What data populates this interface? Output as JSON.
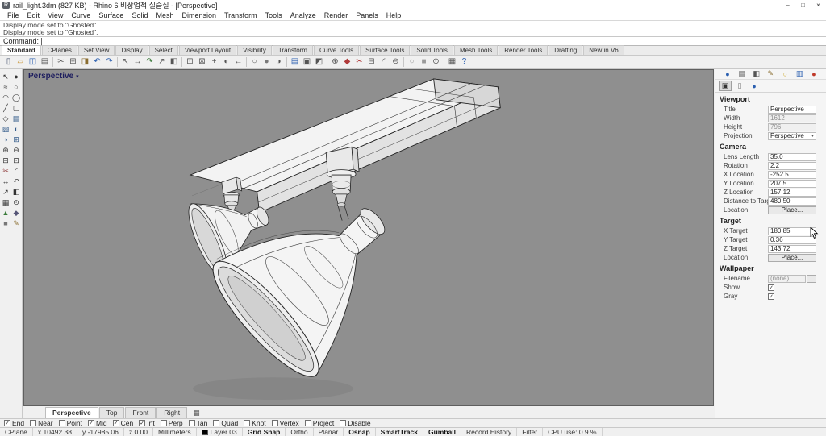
{
  "window": {
    "title": "rail_light.3dm (827 KB) - Rhino 6 비상업적 실습실 - [Perspective]",
    "app_icon_glyph": "R",
    "controls": [
      {
        "name": "minimize",
        "glyph": "–"
      },
      {
        "name": "maximize",
        "glyph": "□"
      },
      {
        "name": "close",
        "glyph": "×"
      }
    ]
  },
  "menubar": {
    "items": [
      "File",
      "Edit",
      "View",
      "Curve",
      "Surface",
      "Solid",
      "Mesh",
      "Dimension",
      "Transform",
      "Tools",
      "Analyze",
      "Render",
      "Panels",
      "Help"
    ]
  },
  "command": {
    "history": [
      "Display mode set to \"Ghosted\".",
      "Display mode set to \"Ghosted\"."
    ],
    "prompt_label": "Command:"
  },
  "toolbar_tabs": {
    "active": "Standard",
    "items": [
      "Standard",
      "CPlanes",
      "Set View",
      "Display",
      "Select",
      "Viewport Layout",
      "Visibility",
      "Transform",
      "Curve Tools",
      "Surface Tools",
      "Solid Tools",
      "Mesh Tools",
      "Render Tools",
      "Drafting",
      "New in V6"
    ]
  },
  "toolbar": {
    "icons": [
      {
        "n": "new-file",
        "g": "▯",
        "c": "#44526b"
      },
      {
        "n": "open-file",
        "g": "▱",
        "c": "#c8922f"
      },
      {
        "n": "save-file",
        "g": "◫",
        "c": "#2b5fb0"
      },
      {
        "n": "print",
        "g": "▤",
        "c": "#555555"
      },
      {
        "sep": true
      },
      {
        "n": "cut",
        "g": "✂",
        "c": "#555555"
      },
      {
        "n": "copy",
        "g": "⊞",
        "c": "#555555"
      },
      {
        "n": "paste",
        "g": "◨",
        "c": "#8a6d2f"
      },
      {
        "n": "undo",
        "g": "↶",
        "c": "#2b5fb0"
      },
      {
        "n": "redo",
        "g": "↷",
        "c": "#2b5fb0"
      },
      {
        "sep": true
      },
      {
        "n": "select",
        "g": "↖",
        "c": "#555555"
      },
      {
        "n": "move",
        "g": "↔",
        "c": "#555555"
      },
      {
        "n": "rotate",
        "g": "↷",
        "c": "#3a7a3a"
      },
      {
        "n": "scale",
        "g": "↗",
        "c": "#555555"
      },
      {
        "n": "mirror",
        "g": "◧",
        "c": "#555555"
      },
      {
        "sep": true
      },
      {
        "n": "zoom-window",
        "g": "⊡",
        "c": "#555555"
      },
      {
        "n": "zoom-extents",
        "g": "⊠",
        "c": "#555555"
      },
      {
        "n": "pan-view",
        "g": "+",
        "c": "#555555"
      },
      {
        "n": "rotate-view",
        "g": "◐",
        "c": "#555555"
      },
      {
        "n": "undo-view",
        "g": "←",
        "c": "#555555"
      },
      {
        "sep": true
      },
      {
        "n": "wireframe-display",
        "g": "○",
        "c": "#555555"
      },
      {
        "n": "shaded-display",
        "g": "●",
        "c": "#7a7a7a"
      },
      {
        "n": "ghosted-display",
        "g": "◑",
        "c": "#555555"
      },
      {
        "sep": true
      },
      {
        "n": "layers",
        "g": "▤",
        "c": "#2b5fb0"
      },
      {
        "n": "properties",
        "g": "▣",
        "c": "#555555"
      },
      {
        "n": "display-options",
        "g": "◩",
        "c": "#555555"
      },
      {
        "sep": true
      },
      {
        "n": "join",
        "g": "⊕",
        "c": "#555555"
      },
      {
        "n": "explode",
        "g": "◆",
        "c": "#b03a3a"
      },
      {
        "n": "trim",
        "g": "✂",
        "c": "#b03a3a"
      },
      {
        "n": "split",
        "g": "⊟",
        "c": "#555555"
      },
      {
        "n": "fillet",
        "g": "◜",
        "c": "#555555"
      },
      {
        "n": "offset",
        "g": "⊖",
        "c": "#555555"
      },
      {
        "sep": true
      },
      {
        "n": "hide-object",
        "g": "○",
        "c": "#9a9a9a"
      },
      {
        "n": "lock-object",
        "g": "■",
        "c": "#9a9a9a"
      },
      {
        "n": "group",
        "g": "⊙",
        "c": "#555555"
      },
      {
        "sep": true
      },
      {
        "n": "grid-snap-toggle",
        "g": "▦",
        "c": "#555555"
      },
      {
        "n": "help",
        "g": "?",
        "c": "#2b5fb0"
      }
    ]
  },
  "palette": {
    "icons": [
      {
        "n": "select-arrow",
        "g": "↖",
        "c": "#333333"
      },
      {
        "n": "point",
        "g": "●",
        "c": "#333333"
      },
      {
        "n": "curve-freeform",
        "g": "≈",
        "c": "#333333"
      },
      {
        "n": "circle",
        "g": "○",
        "c": "#333333"
      },
      {
        "n": "arc",
        "g": "◠",
        "c": "#333333"
      },
      {
        "n": "ellipse",
        "g": "◯",
        "c": "#333333"
      },
      {
        "n": "polyline",
        "g": "╱",
        "c": "#333333"
      },
      {
        "n": "rectangle",
        "g": "▢",
        "c": "#333333"
      },
      {
        "n": "polygon",
        "g": "◇",
        "c": "#333333"
      },
      {
        "n": "surface-plane",
        "g": "▤",
        "c": "#335b8a"
      },
      {
        "n": "surface-corner",
        "g": "▧",
        "c": "#335b8a"
      },
      {
        "n": "revolve",
        "g": "◐",
        "c": "#335b8a"
      },
      {
        "n": "sweep",
        "g": "◑",
        "c": "#335b8a"
      },
      {
        "n": "extrude",
        "g": "⊞",
        "c": "#335b8a"
      },
      {
        "n": "boolean-union",
        "g": "⊕",
        "c": "#333333"
      },
      {
        "n": "boolean-difference",
        "g": "⊖",
        "c": "#333333"
      },
      {
        "n": "split",
        "g": "⊟",
        "c": "#333333"
      },
      {
        "n": "project",
        "g": "⊡",
        "c": "#333333"
      },
      {
        "n": "trim",
        "g": "✂",
        "c": "#8a3333"
      },
      {
        "n": "fillet-curve",
        "g": "◜",
        "c": "#333333"
      },
      {
        "n": "move",
        "g": "↔",
        "c": "#333333"
      },
      {
        "n": "rotate",
        "g": "↶",
        "c": "#333333"
      },
      {
        "n": "scale",
        "g": "↗",
        "c": "#333333"
      },
      {
        "n": "mirror",
        "g": "◧",
        "c": "#333333"
      },
      {
        "n": "array",
        "g": "▦",
        "c": "#333333"
      },
      {
        "n": "orient",
        "g": "⊙",
        "c": "#333333"
      },
      {
        "n": "mesh-tools",
        "g": "▲",
        "c": "#3a7a3a"
      },
      {
        "n": "solid-tools",
        "g": "◆",
        "c": "#555577"
      },
      {
        "n": "lock",
        "g": "■",
        "c": "#777777"
      },
      {
        "n": "annotate",
        "g": "✎",
        "c": "#8a6d2f"
      }
    ]
  },
  "viewport": {
    "title": "Perspective",
    "dropdown_glyph": "▾",
    "bg_color": "#8f8f8f"
  },
  "right_panel": {
    "tab_icons": [
      {
        "n": "properties-tab",
        "g": "●",
        "c": "#2b5fb0"
      },
      {
        "n": "layers-tab",
        "g": "▤",
        "c": "#555555"
      },
      {
        "n": "display-tab",
        "g": "◧",
        "c": "#555555"
      },
      {
        "n": "pencil-tab",
        "g": "✎",
        "c": "#8a6d2f"
      },
      {
        "n": "lightbulb-tab",
        "g": "○",
        "c": "#c9a21a"
      },
      {
        "n": "help-tab",
        "g": "▥",
        "c": "#2b5fb0"
      },
      {
        "n": "notifications-tab",
        "g": "●",
        "c": "#c03a2a"
      }
    ],
    "subtab_icons": [
      {
        "n": "viewport-subtab",
        "g": "▣",
        "c": "#333333",
        "active": true
      },
      {
        "n": "page-subtab",
        "g": "▯",
        "c": "#777777"
      },
      {
        "n": "material-subtab",
        "g": "●",
        "c": "#2b5fb0"
      }
    ],
    "sections": [
      {
        "title": "Viewport",
        "rows": [
          {
            "label": "Title",
            "value": "Perspective",
            "type": "text"
          },
          {
            "label": "Width",
            "value": "1612",
            "type": "disabled"
          },
          {
            "label": "Height",
            "value": "796",
            "type": "disabled"
          },
          {
            "label": "Projection",
            "value": "Perspective",
            "type": "dropdown"
          }
        ]
      },
      {
        "title": "Camera",
        "rows": [
          {
            "label": "Lens Length",
            "value": "35.0",
            "type": "text"
          },
          {
            "label": "Rotation",
            "value": "2.2",
            "type": "text"
          },
          {
            "label": "X Location",
            "value": "-252.5",
            "type": "text"
          },
          {
            "label": "Y Location",
            "value": "207.5",
            "type": "text"
          },
          {
            "label": "Z Location",
            "value": "157.12",
            "type": "text"
          },
          {
            "label": "Distance to Target",
            "value": "480.50",
            "type": "text"
          },
          {
            "label": "Location",
            "value": "Place...",
            "type": "button"
          }
        ]
      },
      {
        "title": "Target",
        "rows": [
          {
            "label": "X Target",
            "value": "180.85",
            "type": "text"
          },
          {
            "label": "Y Target",
            "value": "0.36",
            "type": "text"
          },
          {
            "label": "Z Target",
            "value": "143.72",
            "type": "text"
          },
          {
            "label": "Location",
            "value": "Place...",
            "type": "button"
          }
        ]
      },
      {
        "title": "Wallpaper",
        "rows": [
          {
            "label": "Filename",
            "value": "(none)",
            "browse_glyph": "…",
            "type": "file"
          },
          {
            "label": "Show",
            "checked": true,
            "type": "checkbox"
          },
          {
            "label": "Gray",
            "checked": true,
            "type": "checkbox"
          }
        ]
      }
    ]
  },
  "viewport_tabs": {
    "active": "Perspective",
    "items": [
      "Perspective",
      "Top",
      "Front",
      "Right"
    ],
    "grid_icon_glyph": "▦"
  },
  "osnap": {
    "items": [
      {
        "label": "End",
        "checked": true
      },
      {
        "label": "Near",
        "checked": false
      },
      {
        "label": "Point",
        "checked": false
      },
      {
        "label": "Mid",
        "checked": true
      },
      {
        "label": "Cen",
        "checked": true
      },
      {
        "label": "Int",
        "checked": true
      },
      {
        "label": "Perp",
        "checked": false
      },
      {
        "label": "Tan",
        "checked": false
      },
      {
        "label": "Quad",
        "checked": false
      },
      {
        "label": "Knot",
        "checked": false
      },
      {
        "label": "Vertex",
        "checked": false
      },
      {
        "label": "Project",
        "checked": false
      },
      {
        "label": "Disable",
        "checked": false
      }
    ],
    "check_glyph": "✓"
  },
  "statusbar": {
    "segments": [
      {
        "label": "CPlane"
      },
      {
        "label": "x 10492.38"
      },
      {
        "label": "y -17985.06"
      },
      {
        "label": "z 0.00"
      },
      {
        "label": "Millimeters"
      },
      {
        "label": "Layer 03",
        "swatch": "#000000"
      },
      {
        "label": "Grid Snap",
        "active": true
      },
      {
        "label": "Ortho"
      },
      {
        "label": "Planar"
      },
      {
        "label": "Osnap",
        "active": true
      },
      {
        "label": "SmartTrack",
        "active": true
      },
      {
        "label": "Gumball",
        "active": true
      },
      {
        "label": "Record History"
      },
      {
        "label": "Filter"
      },
      {
        "label": "CPU use: 0.9 %"
      }
    ]
  }
}
